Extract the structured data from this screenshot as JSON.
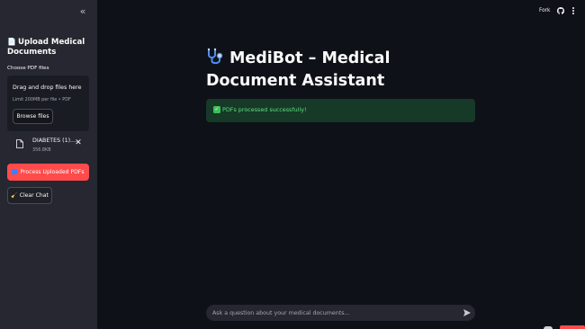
{
  "sidebar": {
    "upload_title": "Upload Medical Documents",
    "uploader_label": "Choose PDF files",
    "dropzone": {
      "title": "Drag and drop files here",
      "limit": "Limit 200MB per file • PDF",
      "browse_label": "Browse files"
    },
    "file": {
      "name": "DIABETES (1)....",
      "size": "356.8KB"
    },
    "process_label": "Process Uploaded PDFs",
    "clear_label": "Clear Chat"
  },
  "header": {
    "fork_label": "Fork"
  },
  "main": {
    "title": "MediBot – Medical Document Assistant",
    "success_message": "PDFs processed successfully!",
    "chat_placeholder": "Ask a question about your medical documents..."
  },
  "icons": {
    "collapse": "double-chevron-left-icon",
    "document": "page-icon",
    "file": "file-icon",
    "remove": "close-icon",
    "process": "refresh-icon",
    "clear": "broom-icon",
    "github": "github-icon",
    "menu": "vertical-dots-icon",
    "title": "stethoscope-icon",
    "success": "check-icon",
    "send": "send-icon"
  },
  "colors": {
    "background": "#0e1117",
    "sidebar": "#262730",
    "primary": "#ff4b4b",
    "success_bg": "#173928",
    "success_text": "#5ee07f"
  }
}
